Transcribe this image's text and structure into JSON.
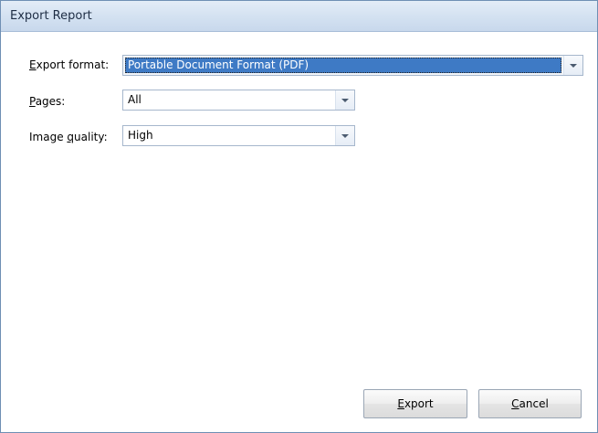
{
  "dialog": {
    "title": "Export Report"
  },
  "form": {
    "export_format": {
      "label_accel": "E",
      "label_rest": "xport format:",
      "value": "Portable Document Format (PDF)"
    },
    "pages": {
      "label_accel": "P",
      "label_rest": "ages:",
      "value": "All"
    },
    "image_quality": {
      "label_pre": "Image ",
      "label_accel": "q",
      "label_rest": "uality:",
      "value": "High"
    }
  },
  "buttons": {
    "export_accel": "E",
    "export_rest": "xport",
    "cancel_accel": "C",
    "cancel_rest": "ancel"
  },
  "icons": {
    "dropdown": "chevron-down-icon"
  },
  "colors": {
    "titlebar": "#d3e1f1",
    "selection": "#3e7ac5",
    "border": "#6f8fb4"
  }
}
